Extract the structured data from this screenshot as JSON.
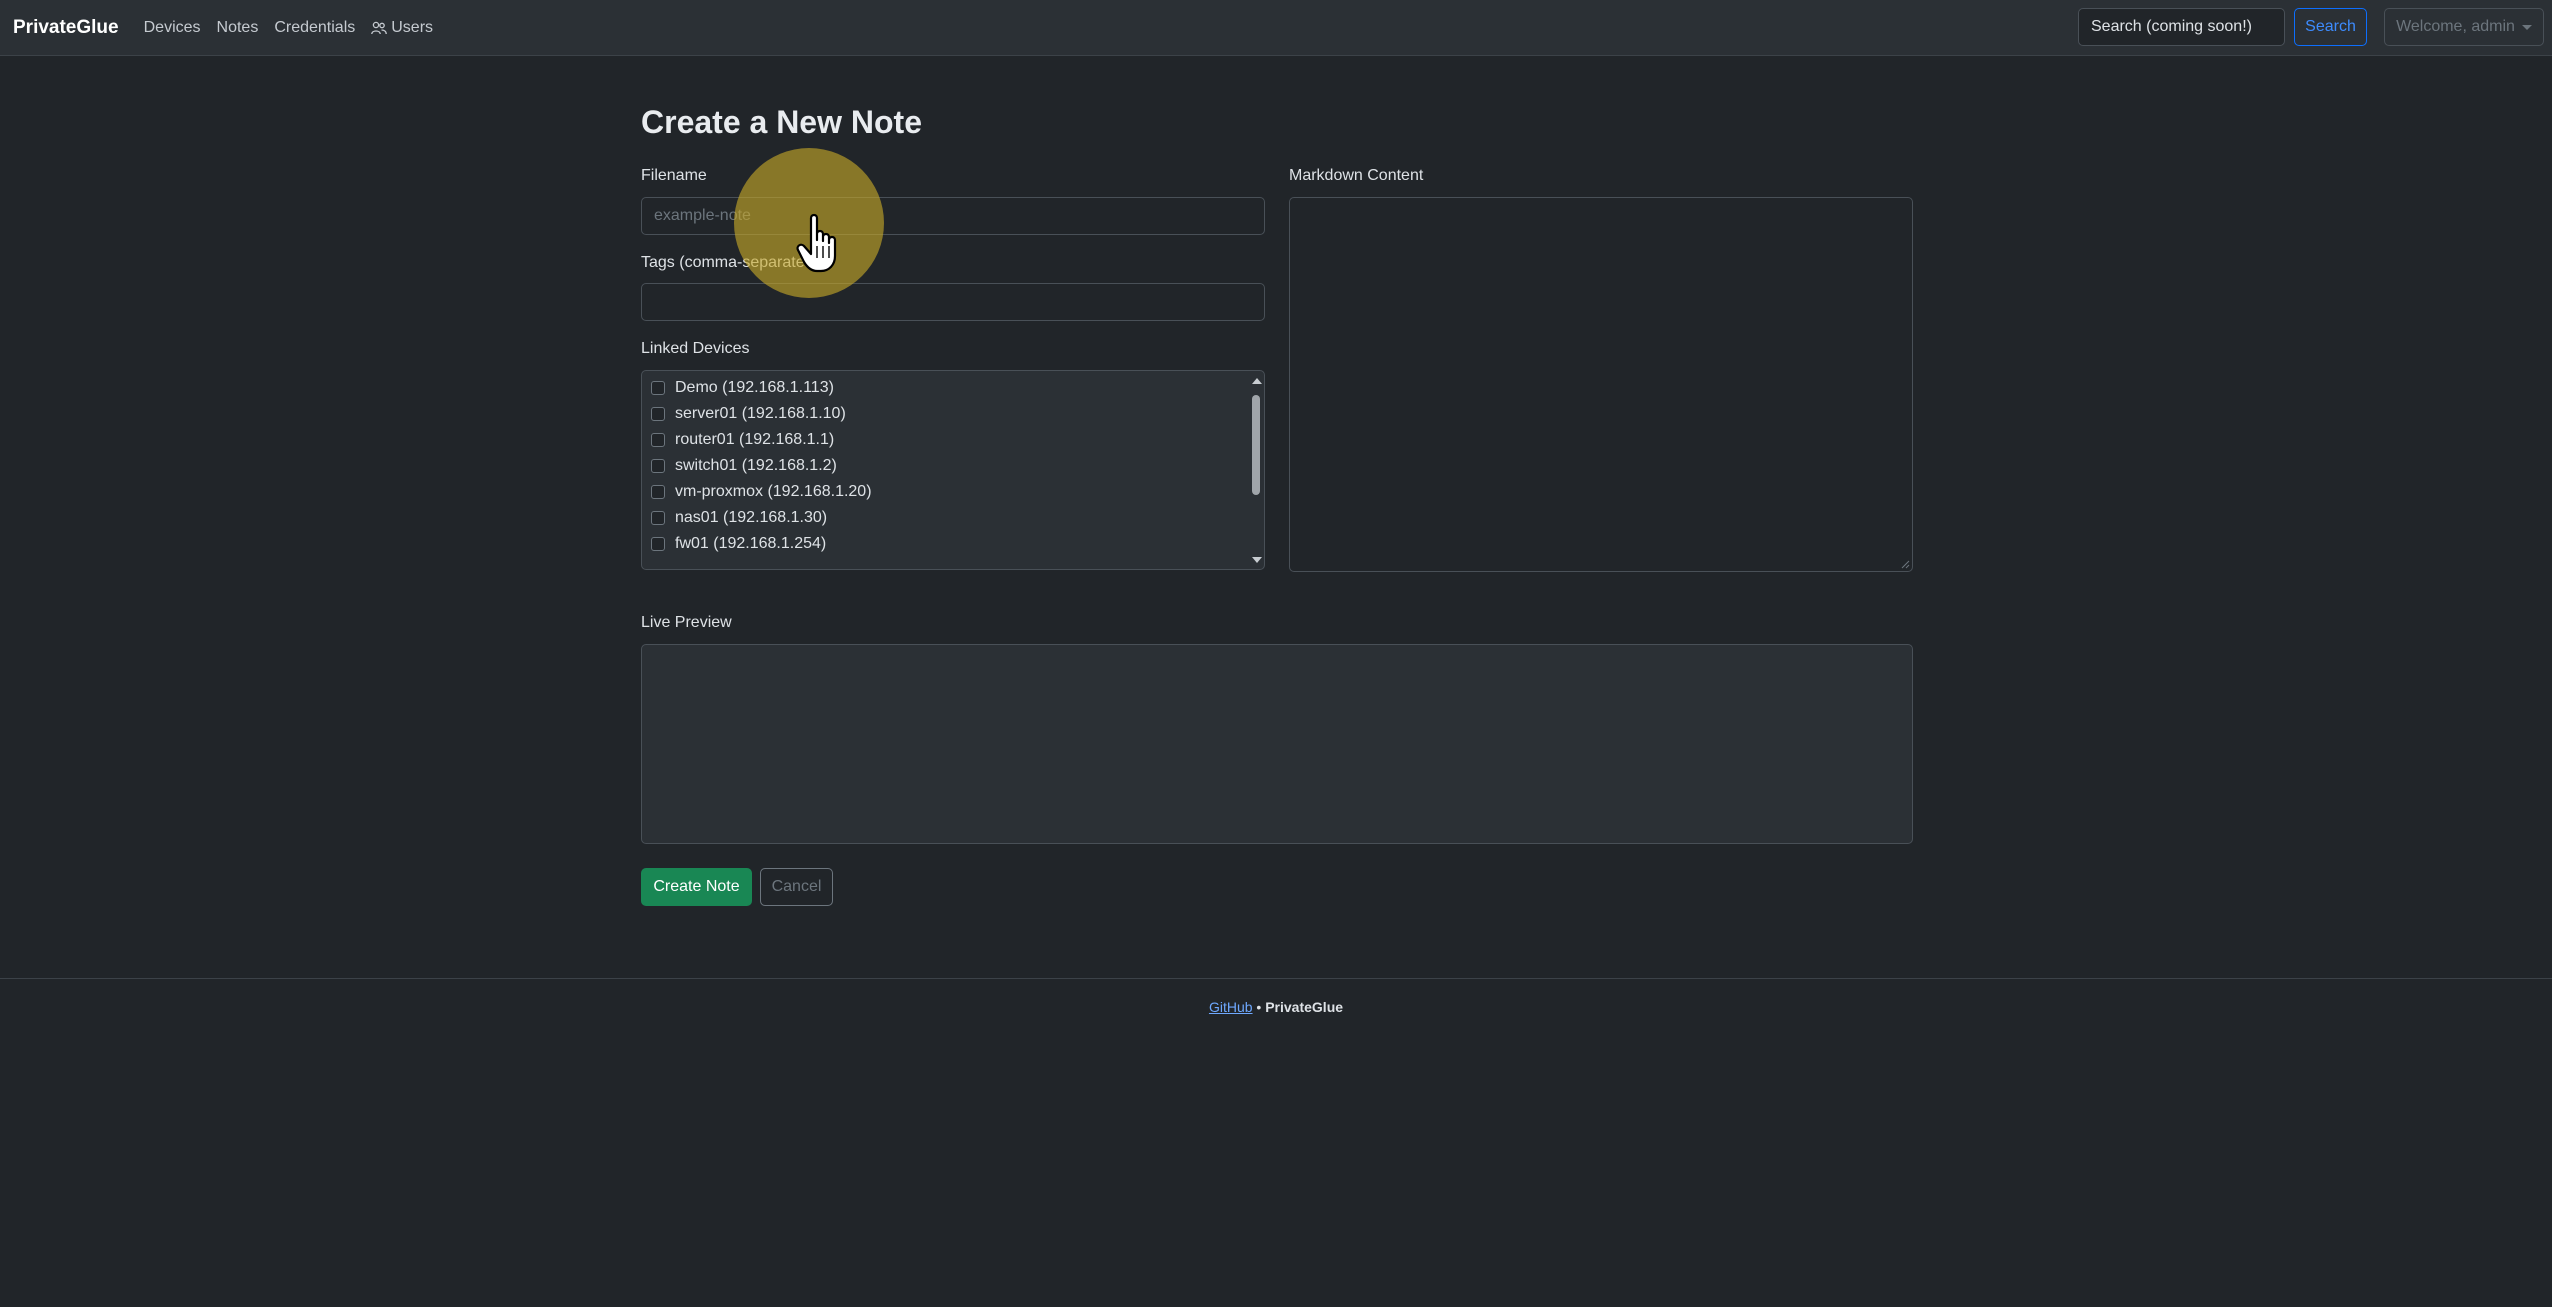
{
  "navbar": {
    "brand": "PrivateGlue",
    "links": [
      "Devices",
      "Notes",
      "Credentials",
      "Users"
    ],
    "search_placeholder": "Search (coming soon!)",
    "search_button": "Search",
    "user_menu": "Welcome, admin"
  },
  "form": {
    "title": "Create a New Note",
    "filename_label": "Filename",
    "filename_placeholder": "example-note",
    "filename_value": "",
    "tags_label": "Tags (comma-separated)",
    "tags_value": "",
    "linked_devices_label": "Linked Devices",
    "devices": [
      {
        "label": "Demo (192.168.1.113)",
        "checked": false
      },
      {
        "label": "server01 (192.168.1.10)",
        "checked": false
      },
      {
        "label": "router01 (192.168.1.1)",
        "checked": false
      },
      {
        "label": "switch01 (192.168.1.2)",
        "checked": false
      },
      {
        "label": "vm-proxmox (192.168.1.20)",
        "checked": false
      },
      {
        "label": "nas01 (192.168.1.30)",
        "checked": false
      },
      {
        "label": "fw01 (192.168.1.254)",
        "checked": false
      }
    ],
    "markdown_label": "Markdown Content",
    "markdown_value": "",
    "preview_label": "Live Preview",
    "create_button": "Create Note",
    "cancel_button": "Cancel"
  },
  "footer": {
    "link": "GitHub",
    "separator": " • ",
    "app_name": "PrivateGlue"
  },
  "colors": {
    "background": "#212529",
    "navbar": "#2b3035",
    "primary": "#0d6efd",
    "success": "#198754",
    "cursor_highlight": "#c8aa28"
  }
}
